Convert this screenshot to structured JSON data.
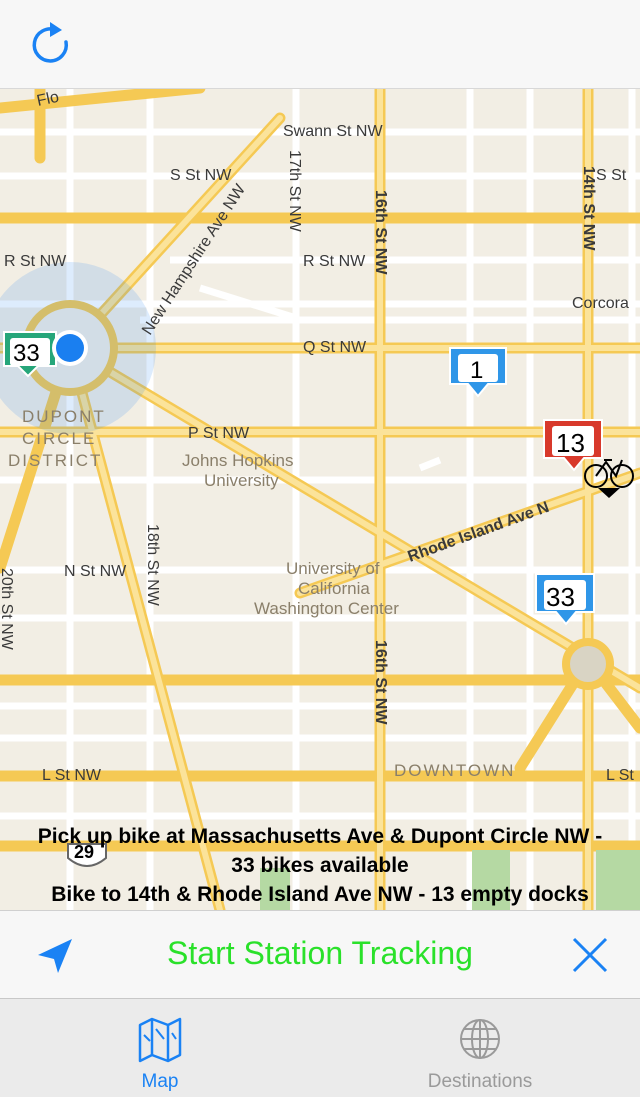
{
  "navbar": {
    "refresh_icon": "refresh-icon"
  },
  "map": {
    "streets": {
      "swann": "Swann St NW",
      "s_st": "S St NW",
      "s_st_right": "S St",
      "r_st_left": "R St NW",
      "r_st_center": "R St NW",
      "q_st": "Q St NW",
      "p_st": "P St NW",
      "n_st": "N St NW",
      "l_st_left": "L St NW",
      "l_st_right": "L St",
      "new_hampshire": "New Hampshire Ave NW",
      "seventeenth": "17th St NW",
      "sixteenth_top": "16th St NW",
      "sixteenth_bottom": "16th St NW",
      "fourteenth": "14th St NW",
      "eighteenth": "18th St NW",
      "twentieth": "20th St NW",
      "rhode_island": "Rhode Island Ave N",
      "corcoran": "Corcora",
      "top_left_fragment": "Flo"
    },
    "areas": {
      "dupont_line1": "DUPONT",
      "dupont_line2": "CIRCLE",
      "dupont_line3": "DISTRICT",
      "downtown": "DOWNTOWN"
    },
    "pois": {
      "jhu_line1": "Johns Hopkins",
      "jhu_line2": "University",
      "uc_line1": "University of",
      "uc_line2": "California",
      "uc_line3": "Washington Center"
    },
    "route_shield": "29",
    "markers": [
      {
        "label": "33",
        "color": "#26a67a"
      },
      {
        "label": "1",
        "color": "#2f96e8"
      },
      {
        "label": "13",
        "color": "#d8392b"
      },
      {
        "label": "33",
        "color": "#2f96e8"
      }
    ],
    "user_location_color": "#1a7ff0"
  },
  "instructions": {
    "line1": "Pick up bike at Massachusetts Ave & Dupont Circle NW -",
    "line2": "33 bikes available",
    "line3": "Bike to 14th & Rhode Island Ave NW - 13 empty docks"
  },
  "actionbar": {
    "start_label": "Start Station Tracking",
    "locate_icon": "location-arrow-icon",
    "close_icon": "close-icon"
  },
  "tabs": [
    {
      "label": "Map",
      "icon": "map-icon",
      "selected": true
    },
    {
      "label": "Destinations",
      "icon": "globe-icon",
      "selected": false
    }
  ],
  "colors": {
    "accent": "#1a82f4",
    "start_tracking": "#2ae12a",
    "map_bg": "#f2eee4",
    "major_road": "#fbd977"
  }
}
